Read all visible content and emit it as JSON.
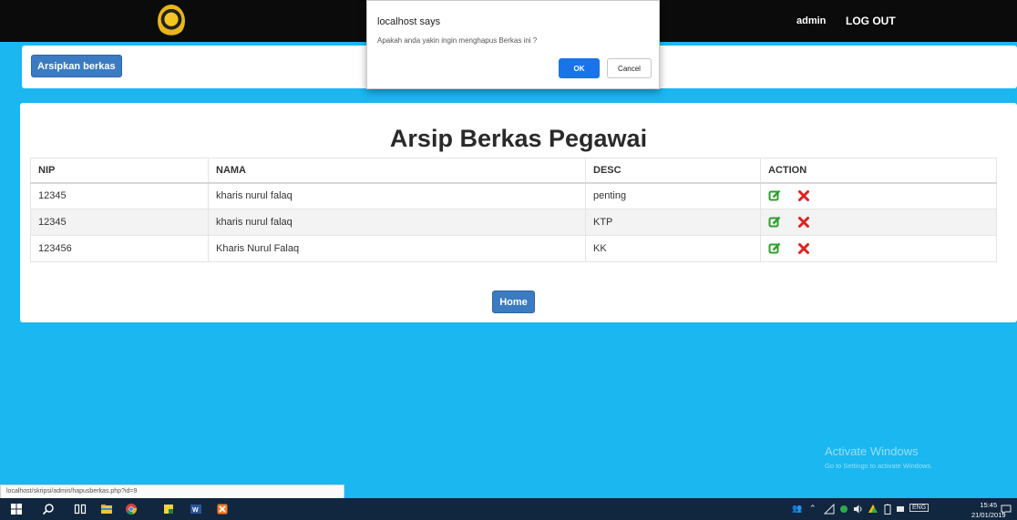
{
  "navbar": {
    "user": "admin",
    "logout_label": "LOG OUT"
  },
  "toolbar": {
    "archive_label": "Arsipkan berkas"
  },
  "main": {
    "title": "Arsip Berkas Pegawai",
    "columns": [
      "NIP",
      "NAMA",
      "DESC",
      "ACTION"
    ],
    "rows": [
      {
        "nip": "12345",
        "nama": "kharis nurul falaq",
        "desc": "penting"
      },
      {
        "nip": "12345",
        "nama": "kharis nurul falaq",
        "desc": "KTP"
      },
      {
        "nip": "123456",
        "nama": "Kharis Nurul Falaq",
        "desc": "KK"
      }
    ],
    "home_label": "Home"
  },
  "dialog": {
    "title": "localhost says",
    "message": "Apakah anda yakin ingin menghapus Berkas ini ?",
    "ok_label": "OK",
    "cancel_label": "Cancel"
  },
  "watermark": {
    "line1": "Activate Windows",
    "line2": "Go to Settings to activate Windows."
  },
  "status_url": "localhost/skripsi/admin/hapusberkas.php?id=9",
  "taskbar": {
    "time": "15:45",
    "date": "21/01/2019",
    "lang": "ENG"
  },
  "colors": {
    "page_bg": "#1ab7f0",
    "button_primary": "#3b7bc2",
    "edit_icon": "#2e9e2e",
    "delete_icon": "#e02020",
    "dialog_ok": "#1a73e8"
  }
}
